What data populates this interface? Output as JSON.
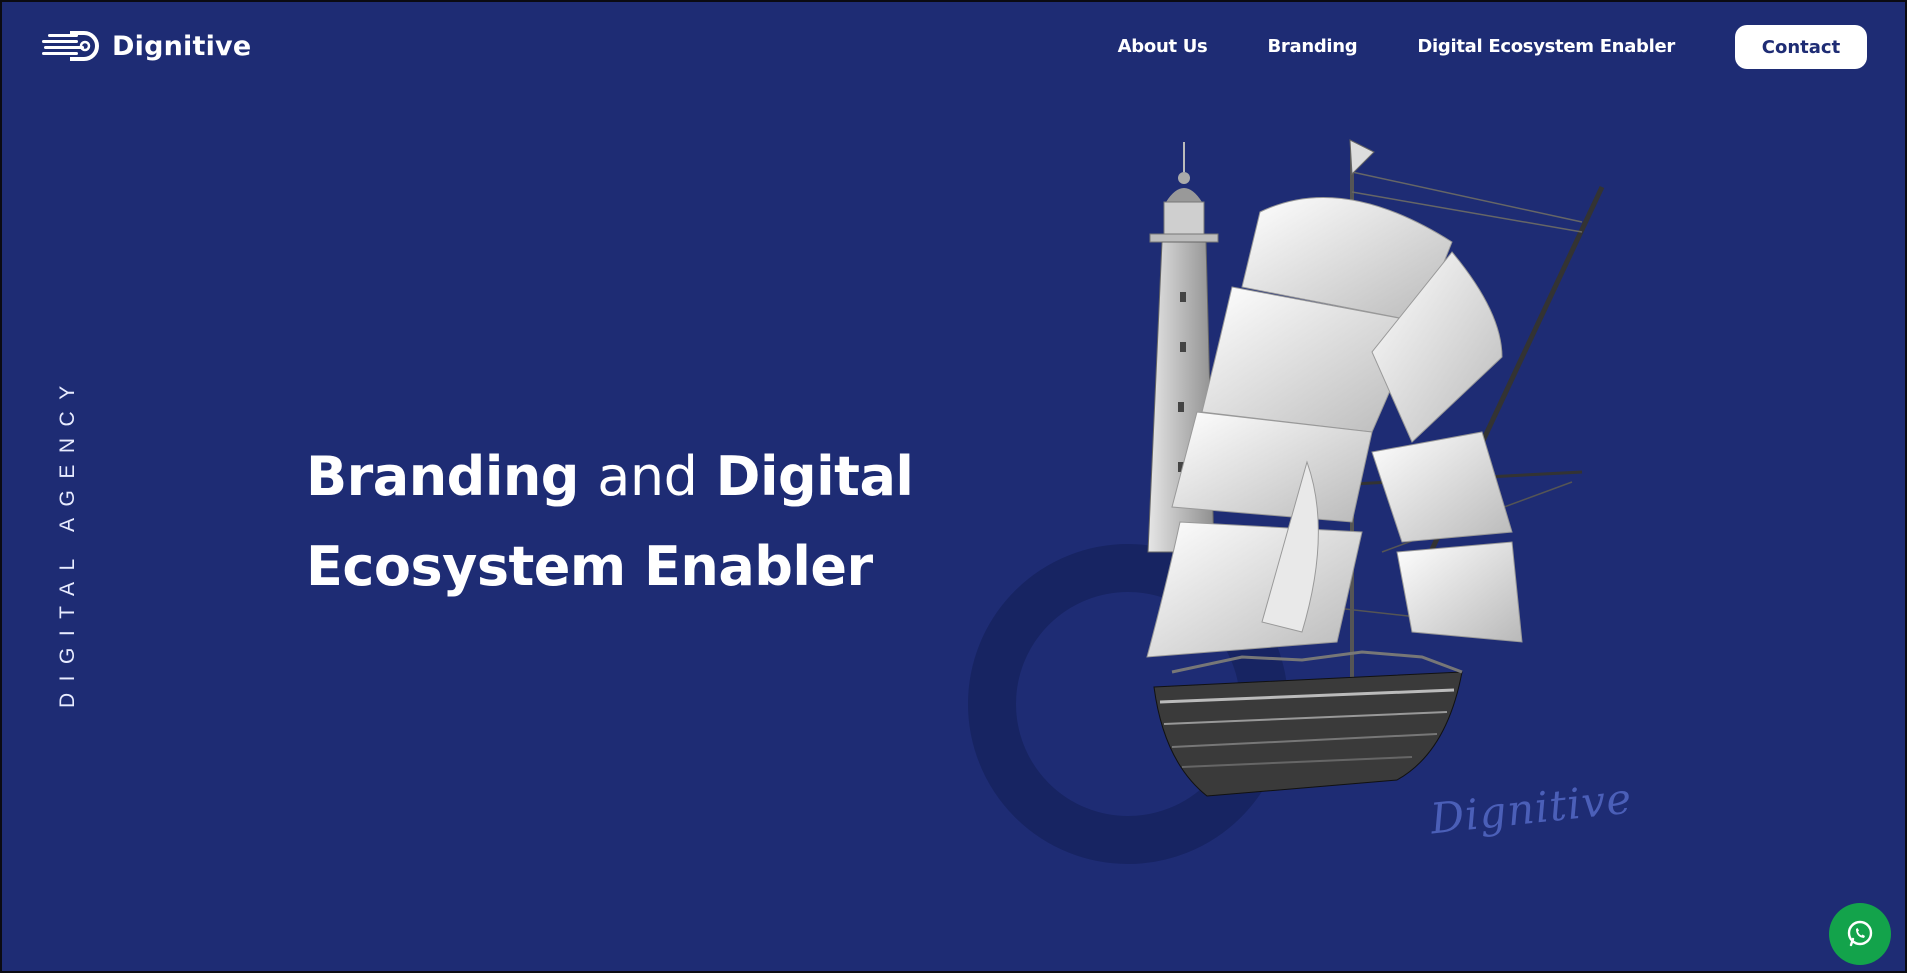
{
  "brand": {
    "name": "Dignitive"
  },
  "nav": {
    "items": [
      {
        "label": "About Us"
      },
      {
        "label": "Branding"
      },
      {
        "label": "Digital Ecosystem Enabler"
      }
    ],
    "contact_label": "Contact"
  },
  "side_label": "DIGITAL AGENCY",
  "hero": {
    "line1_bold_a": "Branding",
    "line1_light": "and",
    "line1_bold_b": "Digital",
    "line2": "Ecosystem Enabler"
  },
  "signature_text": "Dignitive",
  "icons": {
    "logo": "dignitive-logo-mark",
    "whatsapp": "whatsapp-icon"
  },
  "colors": {
    "background": "#1e2c74",
    "ring": "#172462",
    "contact_bg": "#ffffff",
    "contact_text": "#1e2c74",
    "whatsapp": "#13a34b"
  }
}
